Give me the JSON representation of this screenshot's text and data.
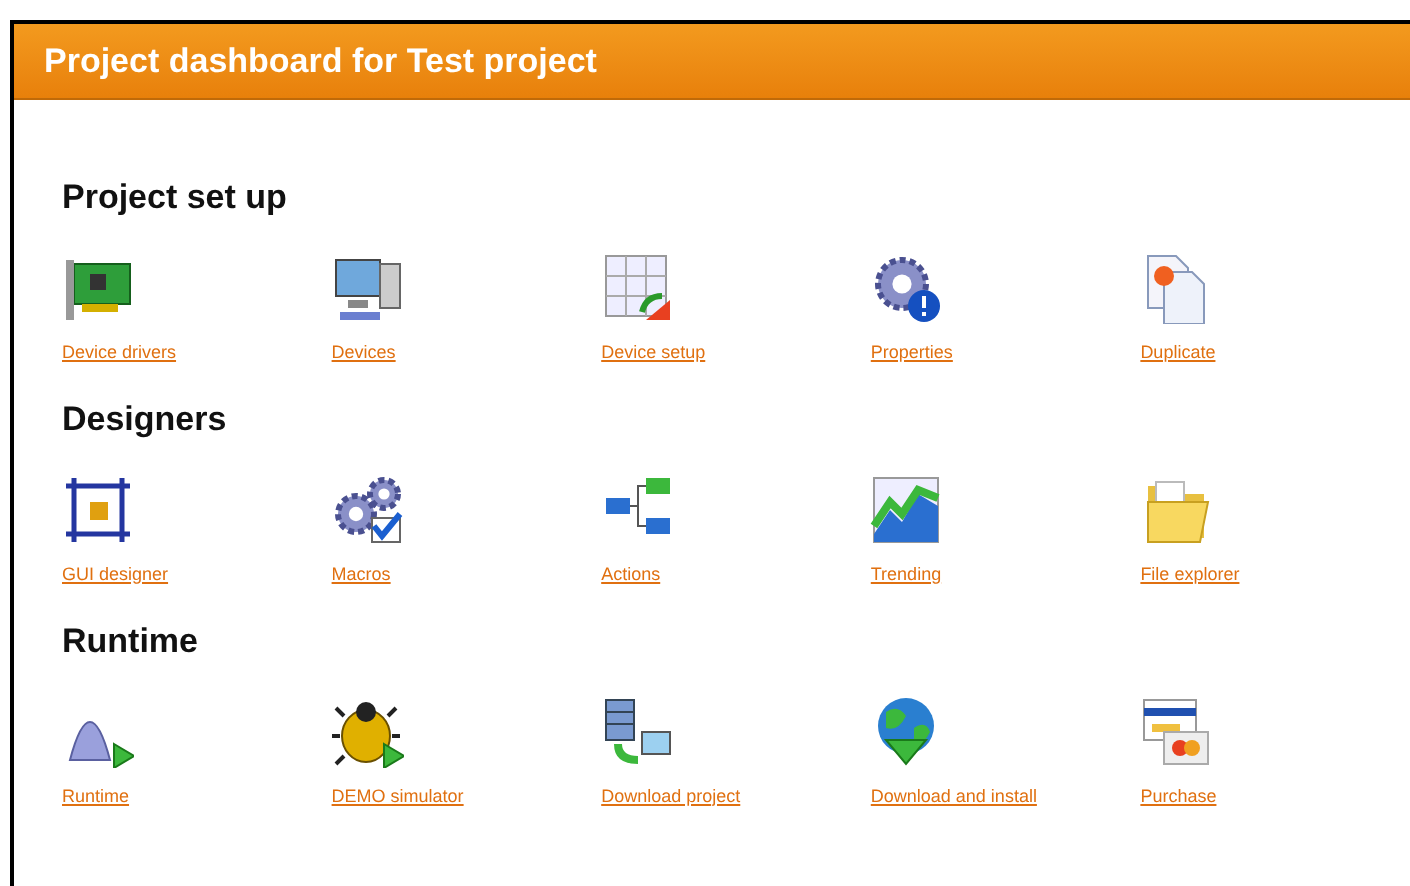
{
  "header": {
    "title": "Project dashboard for Test project"
  },
  "sections": [
    {
      "title": "Project set up",
      "items": [
        {
          "label": "Device drivers"
        },
        {
          "label": "Devices"
        },
        {
          "label": "Device setup"
        },
        {
          "label": "Properties"
        },
        {
          "label": "Duplicate"
        }
      ]
    },
    {
      "title": "Designers",
      "items": [
        {
          "label": "GUI designer"
        },
        {
          "label": "Macros"
        },
        {
          "label": "Actions"
        },
        {
          "label": "Trending"
        },
        {
          "label": "File explorer"
        }
      ]
    },
    {
      "title": "Runtime",
      "items": [
        {
          "label": "Runtime"
        },
        {
          "label": "DEMO simulator"
        },
        {
          "label": "Download project"
        },
        {
          "label": "Download and install"
        },
        {
          "label": "Purchase"
        }
      ]
    }
  ]
}
